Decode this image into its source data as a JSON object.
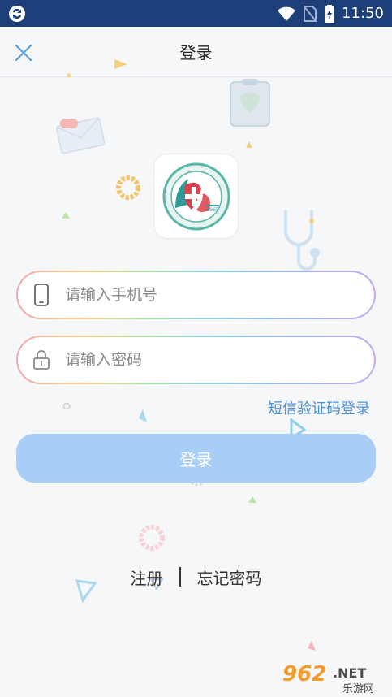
{
  "status_bar": {
    "time": "11:50",
    "icons": [
      "app-icon",
      "wifi-icon",
      "no-sim-icon",
      "battery-icon"
    ]
  },
  "header": {
    "title": "登录",
    "close_icon": "close-icon"
  },
  "logo": {
    "year": "1965"
  },
  "form": {
    "phone_placeholder": "请输入手机号",
    "password_placeholder": "请输入密码",
    "sms_login_link": "短信验证码登录",
    "login_button": "登录"
  },
  "footer": {
    "register": "注册",
    "forgot_password": "忘记密码"
  },
  "watermark": {
    "brand": "962",
    "suffix": ".NET",
    "sub": "乐游网"
  },
  "colors": {
    "status_bar": "#1c3f7a",
    "background": "#f6f7f9",
    "link": "#4a90d9",
    "button": "#a8cdf6",
    "close_icon": "#5aa0e0"
  }
}
